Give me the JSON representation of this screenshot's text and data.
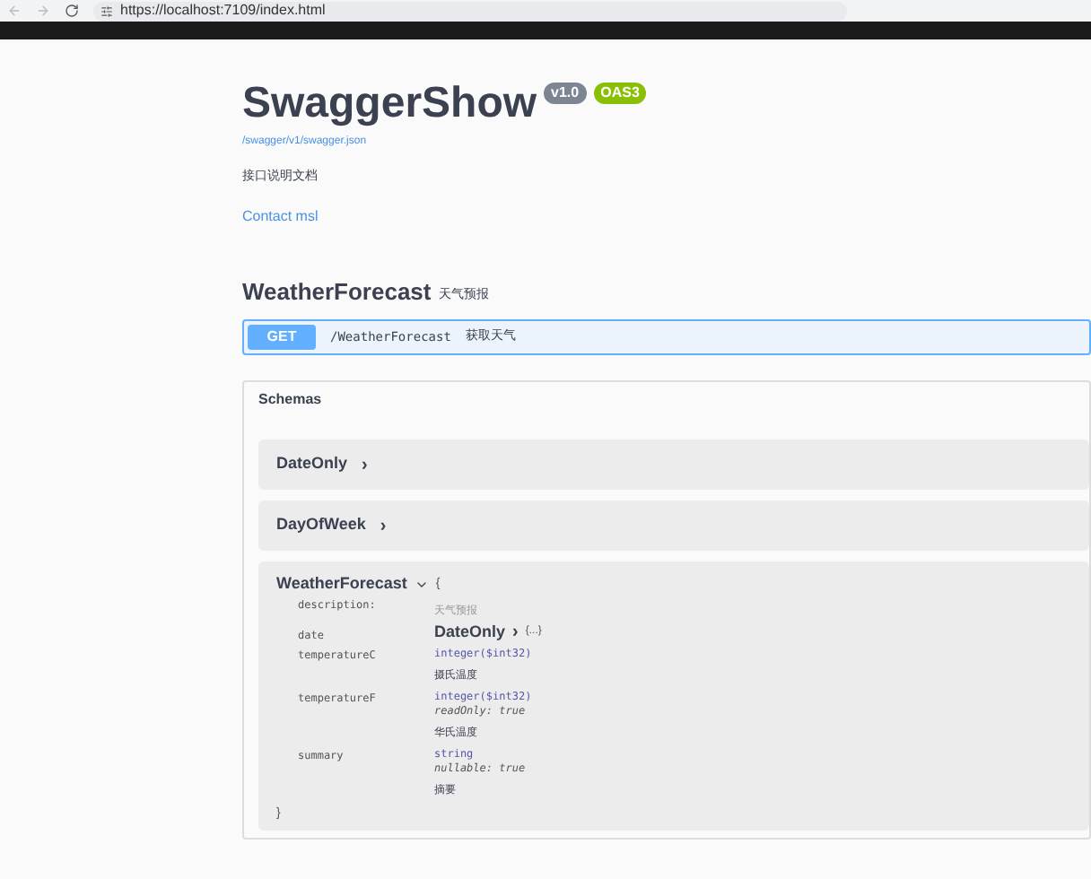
{
  "browser": {
    "url": "https://localhost:7109/index.html"
  },
  "info": {
    "title": "SwaggerShow",
    "version": "v1.0",
    "oas": "OAS3",
    "spec_link": "/swagger/v1/swagger.json",
    "description": "接口说明文档",
    "contact": "Contact msl"
  },
  "tag": {
    "name": "WeatherForecast",
    "description": "天气预报"
  },
  "operation": {
    "method": "GET",
    "path": "/WeatherForecast",
    "summary": "获取天气"
  },
  "schemas": {
    "title": "Schemas",
    "collapsed": [
      {
        "name": "DateOnly",
        "chevron": "›"
      },
      {
        "name": "DayOfWeek",
        "chevron": "›"
      }
    ],
    "expanded": {
      "name": "WeatherForecast",
      "open_brace": "{",
      "close_brace": "}",
      "description_label": "description:",
      "description": "天气预报",
      "properties": [
        {
          "name": "date",
          "kind": "ref",
          "ref": "DateOnly",
          "ref_chevron": "›",
          "ellipsis": "{...}"
        },
        {
          "name": "temperatureC",
          "kind": "type",
          "type": "integer($int32)",
          "desc": "摄氏温度"
        },
        {
          "name": "temperatureF",
          "kind": "type",
          "type": "integer($int32)",
          "extra": "readOnly: true",
          "desc": "华氏温度"
        },
        {
          "name": "summary",
          "kind": "type",
          "type": "string",
          "extra": "nullable: true",
          "desc": "摘要"
        }
      ]
    }
  }
}
